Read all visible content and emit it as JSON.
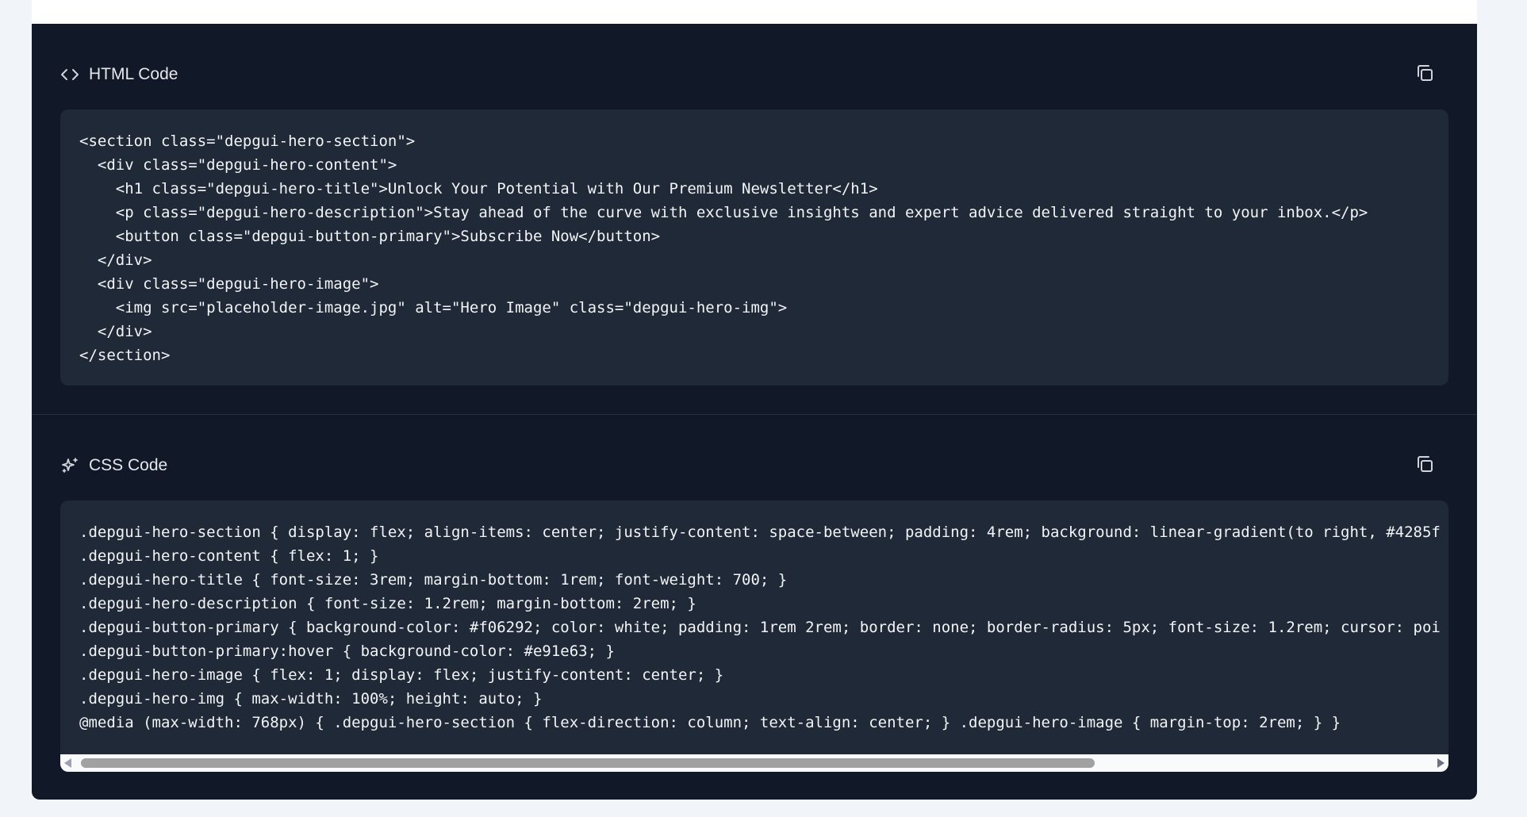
{
  "html_section": {
    "title": "HTML Code",
    "icon": "code-icon",
    "copy_icon": "copy-icon",
    "code": "<section class=\"depgui-hero-section\">\n  <div class=\"depgui-hero-content\">\n    <h1 class=\"depgui-hero-title\">Unlock Your Potential with Our Premium Newsletter</h1>\n    <p class=\"depgui-hero-description\">Stay ahead of the curve with exclusive insights and expert advice delivered straight to your inbox.</p>\n    <button class=\"depgui-button-primary\">Subscribe Now</button>\n  </div>\n  <div class=\"depgui-hero-image\">\n    <img src=\"placeholder-image.jpg\" alt=\"Hero Image\" class=\"depgui-hero-img\">\n  </div>\n</section>"
  },
  "css_section": {
    "title": "CSS Code",
    "icon": "sparkles-icon",
    "copy_icon": "copy-icon",
    "code": ".depgui-hero-section { display: flex; align-items: center; justify-content: space-between; padding: 4rem; background: linear-gradient(to right, #4285f\n.depgui-hero-content { flex: 1; }\n.depgui-hero-title { font-size: 3rem; margin-bottom: 1rem; font-weight: 700; }\n.depgui-hero-description { font-size: 1.2rem; margin-bottom: 2rem; }\n.depgui-button-primary { background-color: #f06292; color: white; padding: 1rem 2rem; border: none; border-radius: 5px; font-size: 1.2rem; cursor: poi\n.depgui-button-primary:hover { background-color: #e91e63; }\n.depgui-hero-image { flex: 1; display: flex; justify-content: center; }\n.depgui-hero-img { max-width: 100%; height: auto; }\n@media (max-width: 768px) { .depgui-hero-section { flex-direction: column; text-align: center; } .depgui-hero-image { margin-top: 2rem; } }"
  },
  "colors": {
    "panel_bg": "#111827",
    "code_bg": "#1f2937",
    "text": "#f3f4f6",
    "page_bg": "#f1f5f9"
  }
}
